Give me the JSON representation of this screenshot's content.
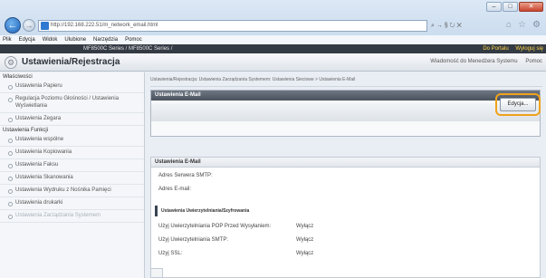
{
  "browser": {
    "url": "http://192.168.222.51/m_network_email.html",
    "addr_tools": "⌕ → § ↻ ✕",
    "menu": [
      "Plik",
      "Edycja",
      "Widok",
      "Ulubione",
      "Narzędzia",
      "Pomoc"
    ],
    "window_buttons": [
      "–",
      "□",
      "✕"
    ]
  },
  "header": {
    "model": "MF8500C Series / MF8500C Series /",
    "portal_link": "Do Portalu",
    "logout_link": "Wyloguj się",
    "title": "Ustawienia/Rejestracja",
    "message_link": "Wiadomość do Menedżera Systemu",
    "help_link": "Pomoc"
  },
  "sidebar": {
    "section1": "Właściwości",
    "items1": [
      "Ustawienia Papieru",
      "Regulacja Poziomu Głośności / Ustawienia Wyświetlania",
      "Ustawienia Zegara"
    ],
    "section2": "Ustawienia Funkcji",
    "items2": [
      "Ustawienia wspólne",
      "Ustawienia Kopiowania",
      "Ustawienia Faksu",
      "Ustawienia Skanowania",
      "Ustawienia Wydruku z Nośnika Pamięci",
      "Ustawienia drukarki",
      "Ustawienia Zarządzania Systemem"
    ]
  },
  "main": {
    "breadcrumb": "Ustawienia/Rejestracja: Ustawienia Zarządzania Systemem: Ustawienia Sieciowe > Ustawienia E-Mail",
    "panel_title": "Ustawienia E-Mail",
    "edit_button": "Edycja...",
    "section_title": "Ustawienia E-Mail",
    "fields": [
      {
        "label": "Adres Serwera SMTP:",
        "value": ""
      },
      {
        "label": "Adres E-mail:",
        "value": ""
      }
    ],
    "auth_title": "Ustawienia Uwierzytelniania/Szyfrowania",
    "auth_rows": [
      {
        "label": "Użyj Uwierzytelniania POP Przed Wysyłaniem:",
        "value": "Wyłącz"
      },
      {
        "label": "Użyj Uwierzytelniania SMTP:",
        "value": "Wyłącz"
      },
      {
        "label": "Użyj SSL:",
        "value": "Wyłącz"
      }
    ]
  },
  "colors": {
    "highlight": "#f0a21c",
    "portal_link": "#ffd449"
  }
}
